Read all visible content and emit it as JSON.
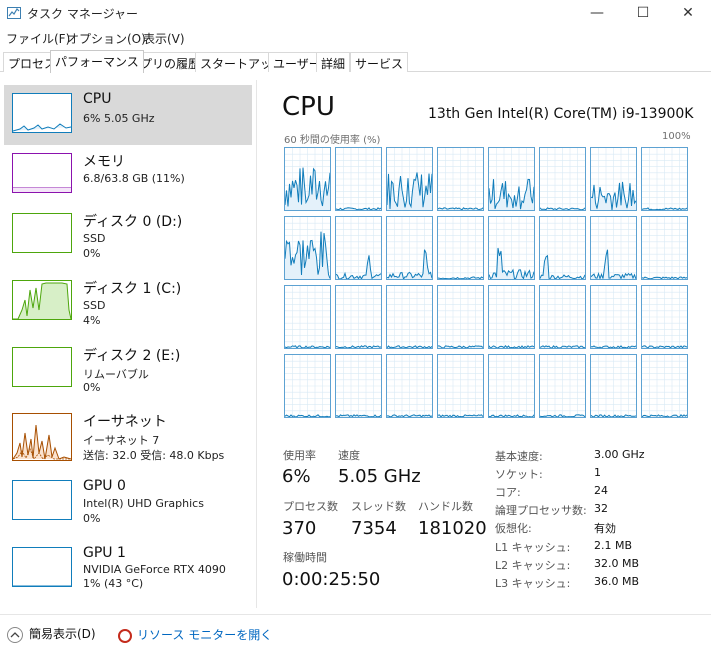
{
  "window": {
    "title": "タスク マネージャー",
    "minimize": "—",
    "maximize": "☐",
    "close": "✕"
  },
  "menu": [
    "ファイル(F)",
    "オプション(O)",
    "表示(V)"
  ],
  "tabs": [
    "プロセス",
    "パフォーマンス",
    "アプリの履歴",
    "スタートアップ",
    "ユーザー",
    "詳細",
    "サービス"
  ],
  "active_tab": "パフォーマンス",
  "sidebar": {
    "items": [
      {
        "name": "CPU",
        "line1": "6%  5.05 GHz",
        "line2": "",
        "color": "#117dbb",
        "selected": true
      },
      {
        "name": "メモリ",
        "line1": "6.8/63.8 GB (11%)",
        "line2": "",
        "color": "#8b12ae"
      },
      {
        "name": "ディスク 0 (D:)",
        "line1": "SSD",
        "line2": "0%",
        "color": "#4da60c"
      },
      {
        "name": "ディスク 1 (C:)",
        "line1": "SSD",
        "line2": "4%",
        "color": "#4da60c"
      },
      {
        "name": "ディスク 2 (E:)",
        "line1": "リムーバブル",
        "line2": "0%",
        "color": "#4da60c"
      },
      {
        "name": "イーサネット",
        "line1": "イーサネット 7",
        "line2": "送信: 32.0 受信: 48.0 Kbps",
        "color": "#a74f01"
      },
      {
        "name": "GPU 0",
        "line1": "Intel(R) UHD Graphics",
        "line2": "0%",
        "color": "#117dbb"
      },
      {
        "name": "GPU 1",
        "line1": "NVIDIA GeForce RTX 4090",
        "line2": "1% (43 °C)",
        "color": "#117dbb"
      }
    ]
  },
  "cpu": {
    "title": "CPU",
    "model": "13th Gen Intel(R) Core(TM) i9-13900K",
    "graph_label": "60 秒間の使用率 (%)",
    "graph_max": "100%",
    "core_count": 32
  },
  "stats": {
    "utilization_label": "使用率",
    "utilization": "6%",
    "speed_label": "速度",
    "speed": "5.05 GHz",
    "processes_label": "プロセス数",
    "processes": "370",
    "threads_label": "スレッド数",
    "threads": "7354",
    "handles_label": "ハンドル数",
    "handles": "181020",
    "uptime_label": "稼働時間",
    "uptime": "0:00:25:50"
  },
  "info": [
    {
      "label": "基本速度:",
      "value": "3.00 GHz"
    },
    {
      "label": "ソケット:",
      "value": "1"
    },
    {
      "label": "コア:",
      "value": "24"
    },
    {
      "label": "論理プロセッサ数:",
      "value": "32"
    },
    {
      "label": "仮想化:",
      "value": "有効"
    },
    {
      "label": "L1 キャッシュ:",
      "value": "2.1 MB"
    },
    {
      "label": "L2 キャッシュ:",
      "value": "32.0 MB"
    },
    {
      "label": "L3 キャッシュ:",
      "value": "36.0 MB"
    }
  ],
  "footer": {
    "fewer_details": "簡易表示(D)",
    "open_resmon": "リソース モニターを開く"
  },
  "colors": {
    "cpu_line": "#117dbb",
    "cpu_fill": "#e4f1fa",
    "grid": "#d9eaf5",
    "border": "#5da2d2"
  }
}
